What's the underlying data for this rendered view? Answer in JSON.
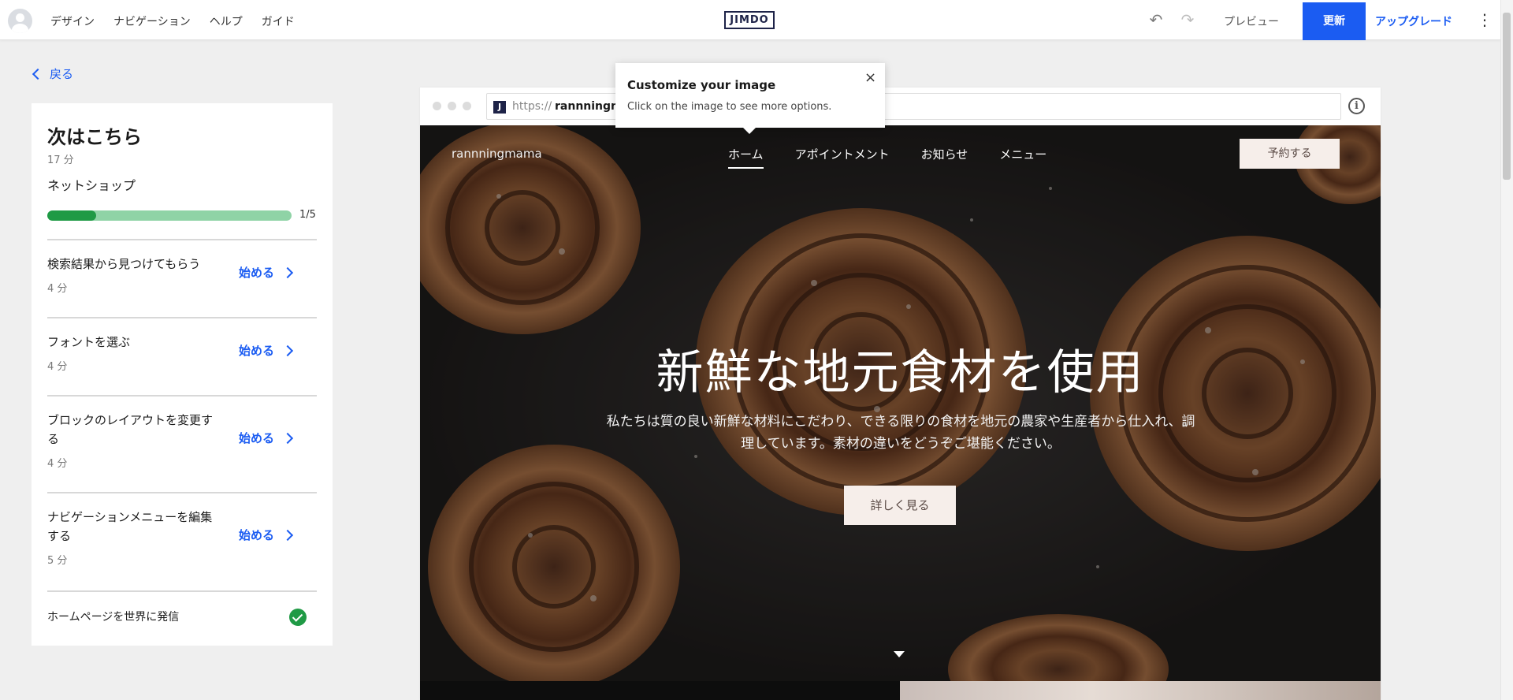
{
  "topbar": {
    "nav": [
      "デザイン",
      "ナビゲーション",
      "ヘルプ",
      "ガイド"
    ],
    "logo": "JIMDO",
    "preview": "プレビュー",
    "update": "更新",
    "upgrade": "アップグレード"
  },
  "sidebar": {
    "back": "戻る",
    "title": "次はこちら",
    "time": "17 分",
    "subtitle": "ネットショップ",
    "progress": {
      "current": 1,
      "total": 5,
      "label": "1/5"
    },
    "tasks": [
      {
        "title": "検索結果から見つけてもらう",
        "time": "4 分",
        "action": "始める"
      },
      {
        "title": "フォントを選ぶ",
        "time": "4 分",
        "action": "始める"
      },
      {
        "title": "ブロックのレイアウトを変更する",
        "time": "4 分",
        "action": "始める"
      },
      {
        "title": "ナビゲーションメニューを編集する",
        "time": "5 分",
        "action": "始める"
      }
    ],
    "completed": "ホームページを世界に発信"
  },
  "browser": {
    "url_prefix": "https://",
    "url_site": "rannningma"
  },
  "site": {
    "name": "rannningmama",
    "nav": [
      "ホーム",
      "アポイントメント",
      "お知らせ",
      "メニュー"
    ],
    "active_nav": "ホーム",
    "book_button": "予約する",
    "headline": "新鮮な地元食材を使用",
    "body": "私たちは質の良い新鮮な材料にこだわり、できる限りの食材を地元の農家や生産者から仕入れ、調理しています。素材の違いをどうぞご堪能ください。",
    "more_button": "詳しく見る"
  },
  "tooltip": {
    "title": "Customize your image",
    "text": "Click on the image to see more options.",
    "close": "×"
  },
  "colors": {
    "accent": "#1b5cf2",
    "progress_fill": "#1f9a45",
    "progress_track": "#8fd3a6",
    "button_bg": "#f6eeea"
  }
}
